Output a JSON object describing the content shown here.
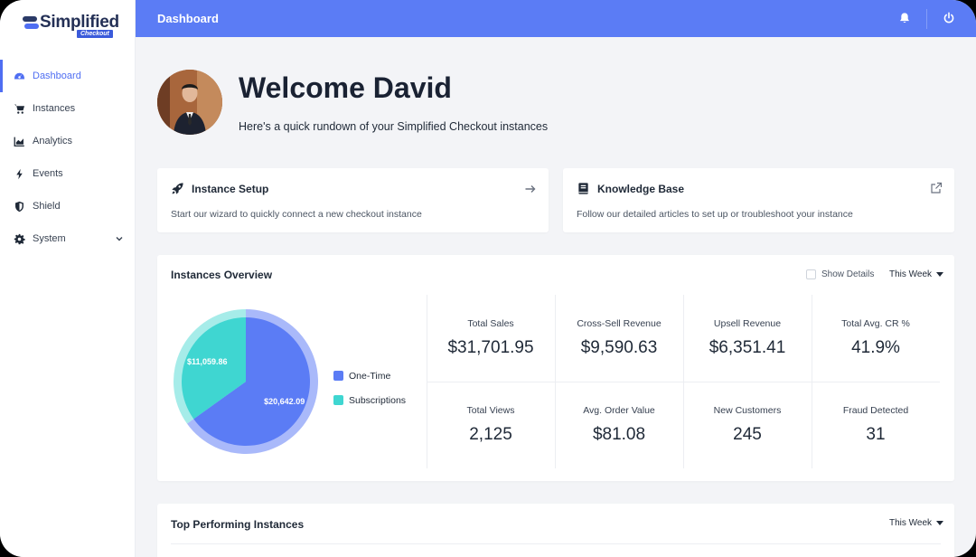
{
  "brand": {
    "name": "Simplified",
    "sub": "Checkout"
  },
  "header": {
    "title": "Dashboard"
  },
  "sidebar": {
    "items": [
      {
        "label": "Dashboard",
        "icon": "gauge-icon",
        "active": true
      },
      {
        "label": "Instances",
        "icon": "cart-icon"
      },
      {
        "label": "Analytics",
        "icon": "chart-icon"
      },
      {
        "label": "Events",
        "icon": "bolt-icon"
      },
      {
        "label": "Shield",
        "icon": "shield-icon"
      },
      {
        "label": "System",
        "icon": "gear-icon",
        "expandable": true
      }
    ]
  },
  "welcome": {
    "title": "Welcome David",
    "subtitle": "Here's a quick rundown of your Simplified Checkout instances"
  },
  "cards": {
    "setup": {
      "title": "Instance Setup",
      "desc": "Start our wizard to quickly connect a new checkout instance",
      "icon": "rocket-icon"
    },
    "kb": {
      "title": "Knowledge Base",
      "desc": "Follow our detailed articles to set up or troubleshoot your instance",
      "icon": "book-icon"
    }
  },
  "overview": {
    "title": "Instances Overview",
    "show_details": "Show Details",
    "period": "This Week",
    "stats": [
      {
        "label": "Total Sales",
        "value": "$31,701.95"
      },
      {
        "label": "Cross-Sell Revenue",
        "value": "$9,590.63"
      },
      {
        "label": "Upsell Revenue",
        "value": "$6,351.41"
      },
      {
        "label": "Total Avg. CR %",
        "value": "41.9%"
      },
      {
        "label": "Total Views",
        "value": "2,125"
      },
      {
        "label": "Avg. Order Value",
        "value": "$81.08"
      },
      {
        "label": "New Customers",
        "value": "245"
      },
      {
        "label": "Fraud Detected",
        "value": "31"
      }
    ]
  },
  "chart_data": {
    "type": "pie",
    "categories": [
      "One-Time",
      "Subscriptions"
    ],
    "values": [
      20642.09,
      11059.86
    ],
    "labels": [
      "$20,642.09",
      "$11,059.86"
    ],
    "colors": [
      "#5b7cf5",
      "#3fd6d1"
    ]
  },
  "top_performing": {
    "title": "Top Performing Instances",
    "period": "This Week"
  },
  "colors": {
    "accent": "#5b7cf5",
    "teal": "#3fd6d1"
  }
}
